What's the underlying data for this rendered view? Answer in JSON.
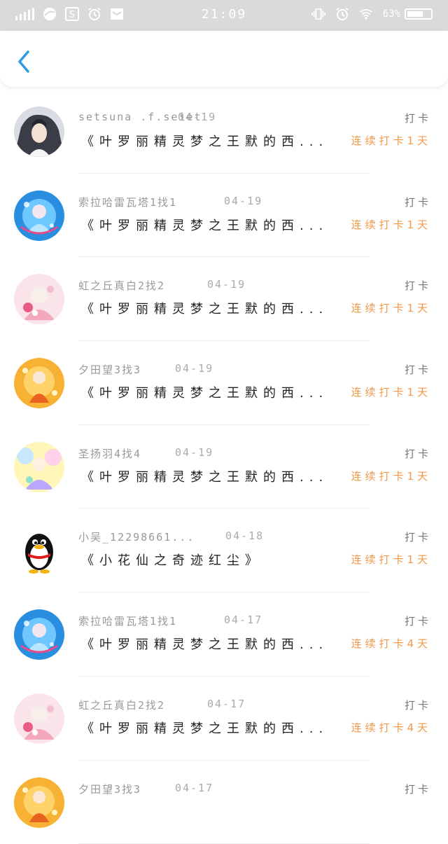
{
  "status": {
    "time": "21:09",
    "battery": "63%",
    "icons": [
      "signal-icon",
      "browser-icon",
      "s-app-icon",
      "alarm-icon",
      "mail-icon",
      "vibrate-icon",
      "alarm-icon",
      "wifi-icon",
      "battery-icon"
    ]
  },
  "nav": {
    "back_icon": "chevron-left-icon",
    "accent": "#2f9ae0"
  },
  "colors": {
    "streak": "#f2994a",
    "name": "#999999"
  },
  "rows": [
    {
      "name": "setsuna .f.seiet",
      "date": "04-19",
      "label": "打卡",
      "title": "《叶罗丽精灵梦之王默的西...",
      "streak": "连续打卡1天",
      "avatar": "avatar-anime-dark"
    },
    {
      "name": "索拉哈雷瓦塔1找1",
      "date": "04-19",
      "label": "打卡",
      "title": "《叶罗丽精灵梦之王默的西...",
      "streak": "连续打卡1天",
      "avatar": "avatar-anime-blue"
    },
    {
      "name": "虹之丘真白2找2",
      "date": "04-19",
      "label": "打卡",
      "title": "《叶罗丽精灵梦之王默的西...",
      "streak": "连续打卡1天",
      "avatar": "avatar-anime-pink"
    },
    {
      "name": "夕田望3找3",
      "date": "04-19",
      "label": "打卡",
      "title": "《叶罗丽精灵梦之王默的西...",
      "streak": "连续打卡1天",
      "avatar": "avatar-anime-orange"
    },
    {
      "name": "圣扬羽4找4",
      "date": "04-19",
      "label": "打卡",
      "title": "《叶罗丽精灵梦之王默的西...",
      "streak": "连续打卡1天",
      "avatar": "avatar-anime-rainbow"
    },
    {
      "name": "小吴_12298661...",
      "date": "04-18",
      "label": "打卡",
      "title": "《小花仙之奇迹红尘》",
      "streak": "连续打卡1天",
      "avatar": "avatar-penguin"
    },
    {
      "name": "索拉哈雷瓦塔1找1",
      "date": "04-17",
      "label": "打卡",
      "title": "《叶罗丽精灵梦之王默的西...",
      "streak": "连续打卡4天",
      "avatar": "avatar-anime-blue"
    },
    {
      "name": "虹之丘真白2找2",
      "date": "04-17",
      "label": "打卡",
      "title": "《叶罗丽精灵梦之王默的西...",
      "streak": "连续打卡4天",
      "avatar": "avatar-anime-pink"
    },
    {
      "name": "夕田望3找3",
      "date": "04-17",
      "label": "打卡",
      "title": "",
      "streak": "",
      "avatar": "avatar-anime-orange"
    }
  ]
}
